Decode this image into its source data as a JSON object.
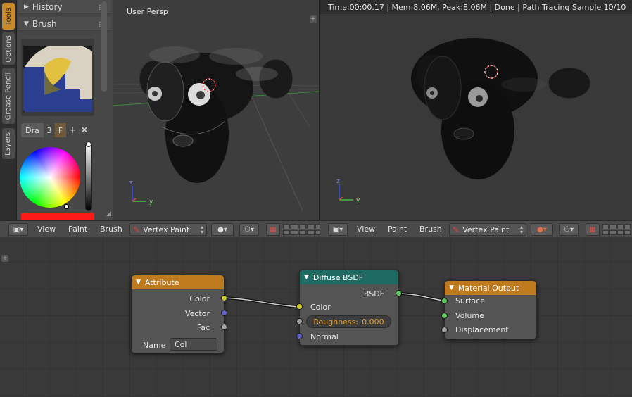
{
  "sidebar_tabs": [
    "Tools",
    "Options",
    "Grease Pencil",
    "Layers"
  ],
  "tool_panel": {
    "history_label": "History",
    "brush_label": "Brush",
    "brush_name": "Dra",
    "brush_users": "3",
    "brush_fake_user": "F",
    "brush_add_icon": "plus-icon",
    "brush_remove_icon": "x-icon",
    "current_color": "#ff1a1a"
  },
  "viewport_left": {
    "label": "User Persp"
  },
  "viewport_right": {
    "status": "Time:00:00.17 | Mem:8.06M, Peak:8.06M | Done | Path Tracing Sample 10/10"
  },
  "header_left": {
    "view": "View",
    "paint": "Paint",
    "brush": "Brush",
    "mode": "Vertex Paint"
  },
  "header_right": {
    "view": "View",
    "paint": "Paint",
    "brush": "Brush",
    "mode": "Vertex Paint"
  },
  "nodes": {
    "attribute": {
      "title": "Attribute",
      "outputs": [
        "Color",
        "Vector",
        "Fac"
      ],
      "name_label": "Name",
      "name_value": "Col",
      "header_color": "#c07a1e"
    },
    "diffuse": {
      "title": "Diffuse BSDF",
      "output": "BSDF",
      "inputs": [
        "Color",
        "Normal"
      ],
      "roughness_label": "Roughness:",
      "roughness_value": "0.000",
      "header_color": "#1f6b63"
    },
    "output": {
      "title": "Material Output",
      "inputs": [
        "Surface",
        "Volume",
        "Displacement"
      ],
      "header_color": "#c07a1e"
    }
  },
  "colors": {
    "accent_orange": "#c98a2a",
    "socket_color": "#c8c830",
    "socket_vector": "#6363c7",
    "socket_float": "#a1a1a1",
    "socket_shader": "#63c763"
  }
}
